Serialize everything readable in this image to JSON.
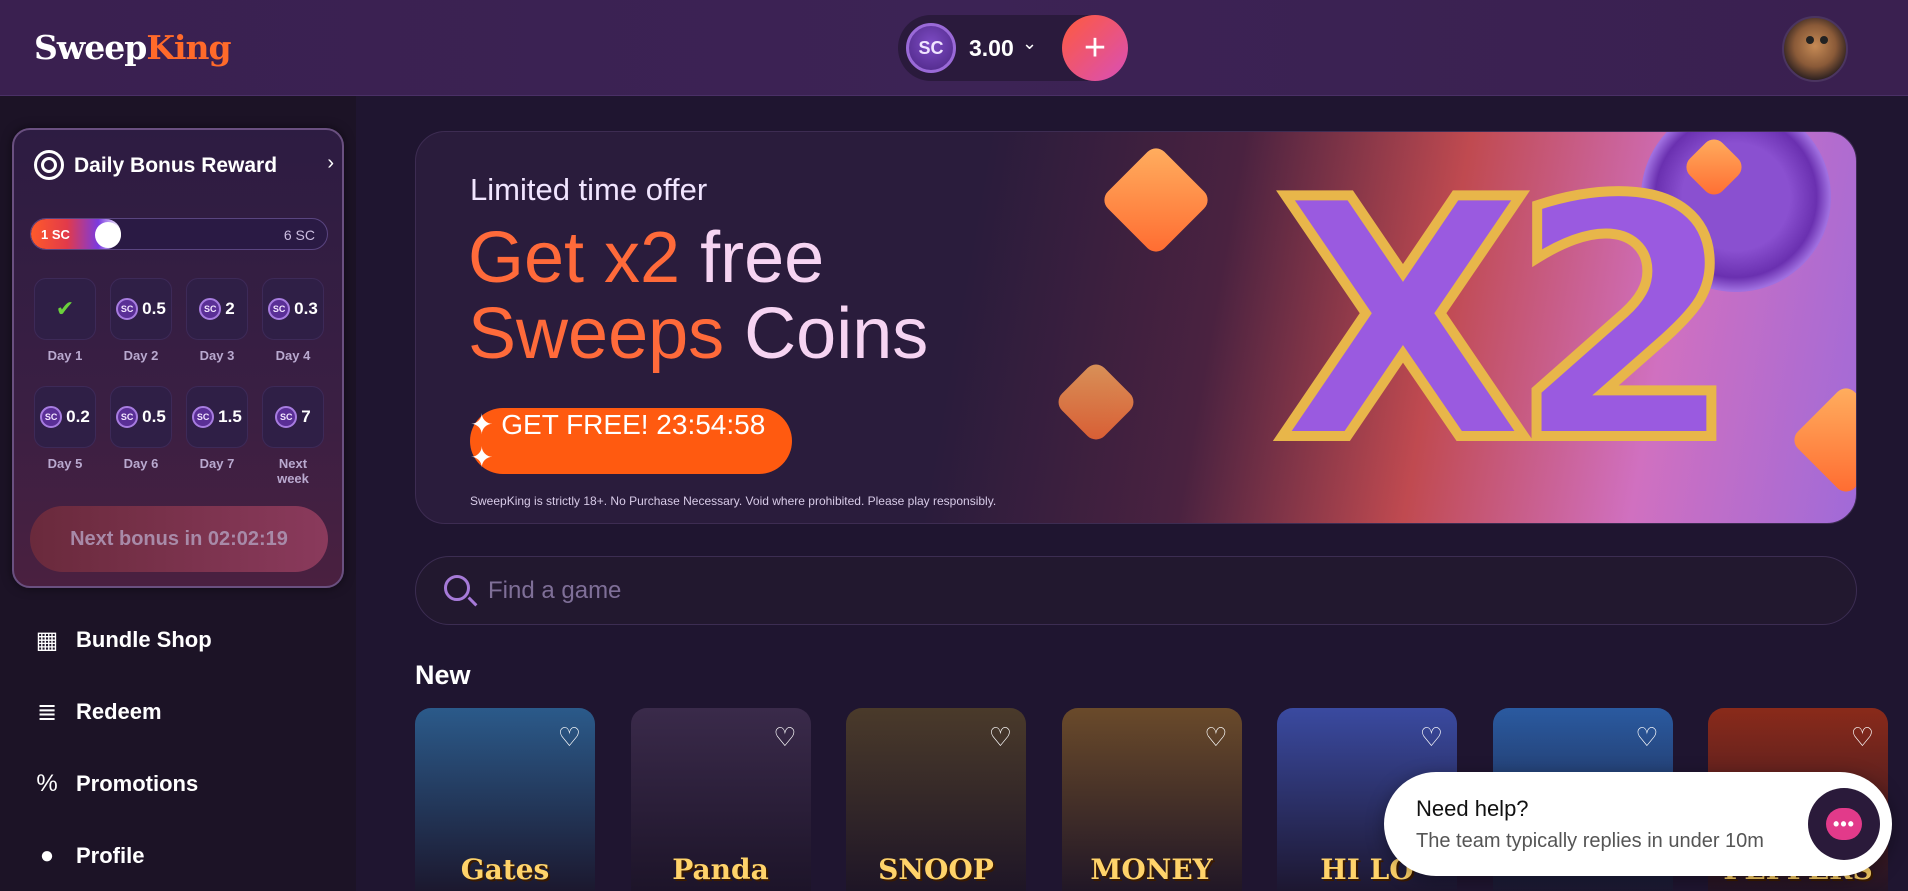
{
  "header": {
    "logo_sweep": "Sweep",
    "logo_king": "King",
    "currency_badge": "SC",
    "balance": "3.00",
    "add_label": "+"
  },
  "bonus": {
    "title": "Daily Bonus Reward",
    "progress_start": "1 SC",
    "progress_end": "6 SC",
    "progress_fraction": 0.2,
    "days": [
      {
        "label": "Day 1",
        "value": "",
        "claimed": true
      },
      {
        "label": "Day 2",
        "value": "0.5",
        "claimed": false
      },
      {
        "label": "Day 3",
        "value": "2",
        "claimed": false
      },
      {
        "label": "Day 4",
        "value": "0.3",
        "claimed": false
      },
      {
        "label": "Day 5",
        "value": "0.2",
        "claimed": false
      },
      {
        "label": "Day 6",
        "value": "0.5",
        "claimed": false
      },
      {
        "label": "Day 7",
        "value": "1.5",
        "claimed": false
      },
      {
        "label": "Next week",
        "value": "7",
        "claimed": false
      }
    ],
    "coin_label": "SC",
    "next_bonus": "Next bonus in 02:02:19"
  },
  "nav": [
    {
      "label": "Bundle Shop",
      "icon": "shop-icon"
    },
    {
      "label": "Redeem",
      "icon": "coins-icon"
    },
    {
      "label": "Promotions",
      "icon": "percent-icon"
    },
    {
      "label": "Profile",
      "icon": "user-icon"
    }
  ],
  "banner": {
    "subtitle": "Limited time offer",
    "headline_line1_a": "Get x2",
    "headline_line1_b": " free",
    "headline_line2_a": "Sweeps",
    "headline_line2_b": " Coins",
    "cta": "✦ GET FREE! 23:54:58 ✦",
    "disclaimer": "SweepKing is strictly 18+. No Purchase Necessary. Void where prohibited. Please play responsibly.",
    "graphic_text": "X2"
  },
  "search": {
    "placeholder": "Find a game"
  },
  "games_section": {
    "title": "New",
    "games": [
      {
        "name": "Gates",
        "bg": "#2b5a8a"
      },
      {
        "name": "Panda",
        "bg": "#3a2a4a"
      },
      {
        "name": "SNOOP",
        "bg": "#4a3a2a"
      },
      {
        "name": "MONEY",
        "bg": "#6a4a2a"
      },
      {
        "name": "HI LO",
        "bg": "#3a4aa0"
      },
      {
        "name": "",
        "bg": "#2a5aa0"
      },
      {
        "name": "PEPPERS",
        "bg": "#8a2a1a"
      }
    ]
  },
  "help": {
    "title": "Need help?",
    "subtitle": "The team typically replies in under 10m"
  },
  "colors": {
    "accent_orange": "#ff5a10",
    "brand_purple": "#9a5ae0"
  }
}
